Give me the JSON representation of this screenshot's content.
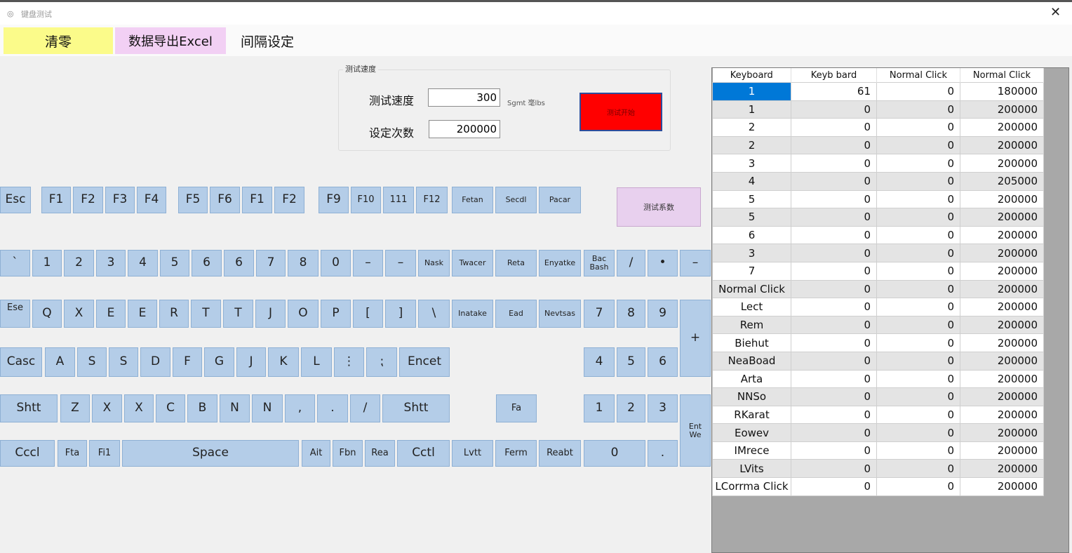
{
  "window": {
    "title": "键盘测试",
    "close_glyph": "✕"
  },
  "toolbar": {
    "clear": "清零",
    "export": "数据导出Excel",
    "interval": "间隔设定"
  },
  "speed_group": {
    "title": "测试速度",
    "speed_label": "测试速度",
    "speed_value": "300",
    "count_label": "设定次数",
    "count_value": "200000",
    "unit": "Sgmt 毫lbs",
    "start_button": "测试开始",
    "start_color": "#ff0000"
  },
  "side_button": "测试系数",
  "keys": {
    "row0": [
      "Esc",
      "F1",
      "F2",
      "F3",
      "F4",
      "F5",
      "F6",
      "F1",
      "F2",
      "F9",
      "F10",
      "111",
      "F12",
      "Fetan",
      "Secdl",
      "Pacar"
    ],
    "row1": [
      "`",
      "1",
      "2",
      "3",
      "4",
      "5",
      "6",
      "6",
      "7",
      "8",
      "0",
      "–",
      "–",
      "Nask",
      "Twacer",
      "Reta",
      "Enyatke",
      "Bac\nBash",
      "/",
      "•",
      "–"
    ],
    "row2": [
      "Ese",
      "Q",
      "X",
      "E",
      "E",
      "R",
      "T",
      "T",
      "J",
      "O",
      "P",
      "[",
      "]",
      "\\",
      "Inatake",
      "Ead",
      "Nevtsas",
      "7",
      "8",
      "9",
      "+"
    ],
    "row3": [
      "Casc",
      "A",
      "S",
      "S",
      "D",
      "F",
      "G",
      "J",
      "K",
      "L",
      "⋮",
      "⁏",
      "Encet",
      "4",
      "5",
      "6"
    ],
    "row4": [
      "Shtt",
      "Z",
      "X",
      "X",
      "C",
      "B",
      "N",
      "N",
      ",",
      ".",
      "/",
      "Shtt",
      "Fa",
      "1",
      "2",
      "3",
      "Ent\nWe"
    ],
    "row5": [
      "Cccl",
      "Fta",
      "Fi1",
      "Space",
      "Ait",
      "Fbn",
      "Rea",
      "Cctl",
      "Lvtt",
      "Ferm",
      "Reabt",
      "0",
      "."
    ]
  },
  "grid": {
    "headers": [
      "Keyboard",
      "Keyb  bard",
      "Normal Click",
      "Normal Click"
    ],
    "rows": [
      [
        "1",
        "61",
        "0",
        "180000"
      ],
      [
        "1",
        "0",
        "0",
        "200000"
      ],
      [
        "2",
        "0",
        "0",
        "200000"
      ],
      [
        "2",
        "0",
        "0",
        "200000"
      ],
      [
        "3",
        "0",
        "0",
        "200000"
      ],
      [
        "4",
        "0",
        "0",
        "205000"
      ],
      [
        "5",
        "0",
        "0",
        "200000"
      ],
      [
        "5",
        "0",
        "0",
        "200000"
      ],
      [
        "6",
        "0",
        "0",
        "200000"
      ],
      [
        "3",
        "0",
        "0",
        "200000"
      ],
      [
        "7",
        "0",
        "0",
        "200000"
      ],
      [
        "Normal Click",
        "0",
        "0",
        "200000"
      ],
      [
        "Lect",
        "0",
        "0",
        "200000"
      ],
      [
        "Rem",
        "0",
        "0",
        "200000"
      ],
      [
        "Biehut",
        "0",
        "0",
        "200000"
      ],
      [
        "NeaBoad",
        "0",
        "0",
        "200000"
      ],
      [
        "Arta",
        "0",
        "0",
        "200000"
      ],
      [
        "NNSo",
        "0",
        "0",
        "200000"
      ],
      [
        "RKarat",
        "0",
        "0",
        "200000"
      ],
      [
        "Eowev",
        "0",
        "0",
        "200000"
      ],
      [
        "IMrece",
        "0",
        "0",
        "200000"
      ],
      [
        "LVits",
        "0",
        "0",
        "200000"
      ],
      [
        "LCorrma Click",
        "0",
        "0",
        "200000"
      ]
    ]
  }
}
